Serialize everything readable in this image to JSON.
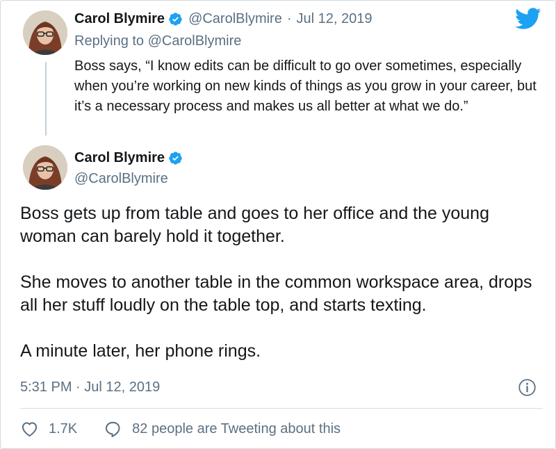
{
  "reply_tweet": {
    "author_name": "Carol Blymire",
    "handle": "@CarolBlymire",
    "separator": "·",
    "date": "Jul 12, 2019",
    "replying_prefix": "Replying to ",
    "replying_to": "@CarolBlymire",
    "text": "Boss says, “I know edits can be difficult to go over sometimes, especially when you’re working on new kinds of things as you grow in your career, but it’s a necessary process and makes us all better at what we do.”"
  },
  "main_tweet": {
    "author_name": "Carol Blymire",
    "handle": "@CarolBlymire",
    "paragraphs": [
      "Boss gets up from table and goes to her office and the young woman can barely hold it together.",
      "She moves to another table in the common workspace area, drops all her stuff loudly on the table top, and starts texting.",
      "A minute later, her phone rings."
    ],
    "timestamp": "5:31 PM · Jul 12, 2019",
    "like_count": "1.7K",
    "tweeting_text": "82 people are Tweeting about this"
  },
  "icons": {
    "verified": "verified-badge-icon",
    "logo": "twitter-bird-icon",
    "info": "info-icon",
    "like": "heart-icon",
    "reply": "speech-bubble-icon"
  },
  "colors": {
    "twitter_blue": "#1da1f2",
    "muted_text": "#5b7083",
    "primary_text": "#14171a"
  }
}
